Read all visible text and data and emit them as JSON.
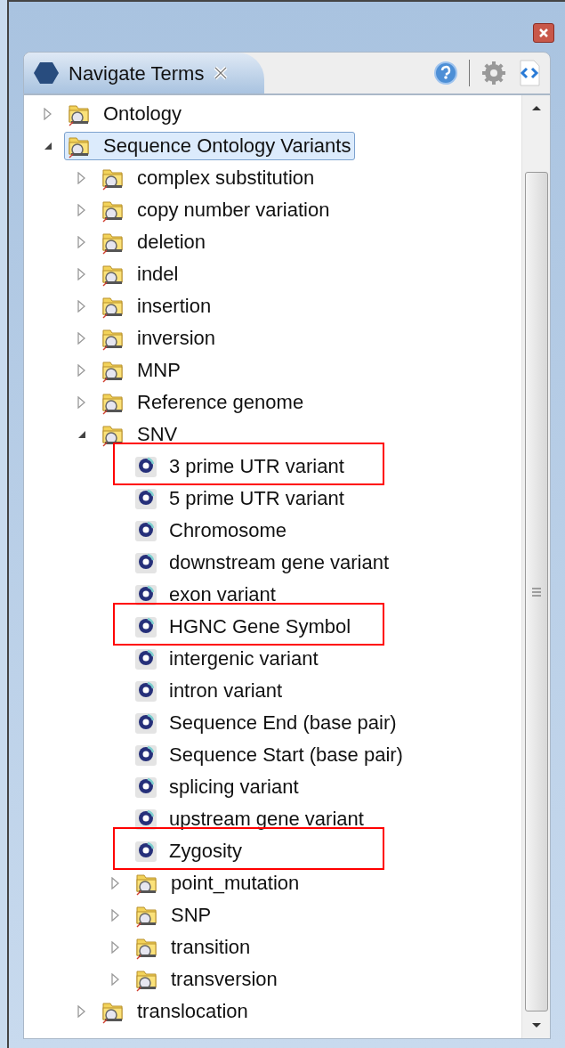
{
  "view": {
    "title": "Navigate Terms"
  },
  "tree": [
    {
      "label": "Ontology",
      "kind": "folder",
      "expanded": false,
      "selected": false,
      "highlighted": false
    },
    {
      "label": "Sequence Ontology Variants",
      "kind": "folder",
      "expanded": true,
      "selected": true,
      "highlighted": false,
      "children": [
        {
          "label": "complex substitution",
          "kind": "folder",
          "expanded": false,
          "selected": false,
          "highlighted": false
        },
        {
          "label": "copy number variation",
          "kind": "folder",
          "expanded": false,
          "selected": false,
          "highlighted": false
        },
        {
          "label": "deletion",
          "kind": "folder",
          "expanded": false,
          "selected": false,
          "highlighted": false
        },
        {
          "label": "indel",
          "kind": "folder",
          "expanded": false,
          "selected": false,
          "highlighted": false
        },
        {
          "label": "insertion",
          "kind": "folder",
          "expanded": false,
          "selected": false,
          "highlighted": false
        },
        {
          "label": "inversion",
          "kind": "folder",
          "expanded": false,
          "selected": false,
          "highlighted": false
        },
        {
          "label": "MNP",
          "kind": "folder",
          "expanded": false,
          "selected": false,
          "highlighted": false
        },
        {
          "label": "Reference genome",
          "kind": "folder",
          "expanded": false,
          "selected": false,
          "highlighted": false
        },
        {
          "label": "SNV",
          "kind": "folder",
          "expanded": true,
          "selected": false,
          "highlighted": false,
          "children": [
            {
              "label": "3 prime UTR variant",
              "kind": "term",
              "selected": false,
              "highlighted": true
            },
            {
              "label": "5 prime UTR variant",
              "kind": "term",
              "selected": false,
              "highlighted": false
            },
            {
              "label": "Chromosome",
              "kind": "term",
              "selected": false,
              "highlighted": false
            },
            {
              "label": "downstream gene variant",
              "kind": "term",
              "selected": false,
              "highlighted": false
            },
            {
              "label": "exon variant",
              "kind": "term",
              "selected": false,
              "highlighted": false
            },
            {
              "label": "HGNC Gene Symbol",
              "kind": "term",
              "selected": false,
              "highlighted": true
            },
            {
              "label": "intergenic variant",
              "kind": "term",
              "selected": false,
              "highlighted": false
            },
            {
              "label": "intron variant",
              "kind": "term",
              "selected": false,
              "highlighted": false
            },
            {
              "label": "Sequence End (base pair)",
              "kind": "term",
              "selected": false,
              "highlighted": false
            },
            {
              "label": "Sequence Start (base pair)",
              "kind": "term",
              "selected": false,
              "highlighted": false
            },
            {
              "label": "splicing variant",
              "kind": "term",
              "selected": false,
              "highlighted": false
            },
            {
              "label": "upstream gene variant",
              "kind": "term",
              "selected": false,
              "highlighted": false
            },
            {
              "label": "Zygosity",
              "kind": "term",
              "selected": false,
              "highlighted": true
            },
            {
              "label": "point_mutation",
              "kind": "folder",
              "expanded": false,
              "selected": false,
              "highlighted": false
            },
            {
              "label": "SNP",
              "kind": "folder",
              "expanded": false,
              "selected": false,
              "highlighted": false
            },
            {
              "label": "transition",
              "kind": "folder",
              "expanded": false,
              "selected": false,
              "highlighted": false
            },
            {
              "label": "transversion",
              "kind": "folder",
              "expanded": false,
              "selected": false,
              "highlighted": false
            }
          ]
        },
        {
          "label": "translocation",
          "kind": "folder",
          "expanded": false,
          "selected": false,
          "highlighted": false
        }
      ]
    }
  ]
}
